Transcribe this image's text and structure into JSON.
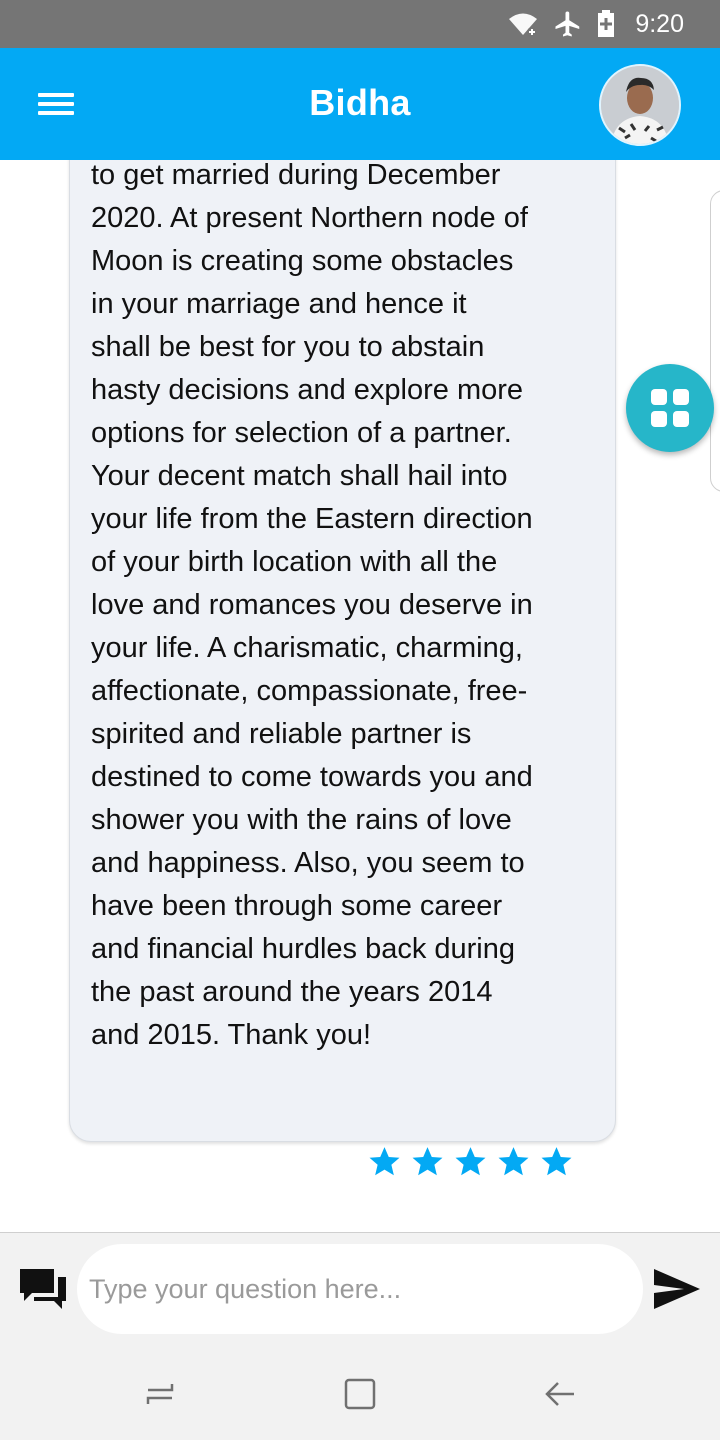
{
  "status_bar": {
    "time": "9:20",
    "icons": [
      "wifi-icon",
      "airplane-mode-icon",
      "battery-icon"
    ]
  },
  "header": {
    "title": "Bidha",
    "menu_icon": "hamburger-menu-icon",
    "avatar": "user-avatar"
  },
  "message": {
    "text": "foreseen circumstances, you have\nanother equally favorable time\nto get married during December\n2020. At present Northern node of\nMoon is creating some obstacles\nin your marriage and hence it\nshall be best for you to abstain\nhasty decisions and explore more\noptions for selection of a partner.\nYour decent match shall hail into\nyour life from the Eastern direction\nof your birth location with all the\nlove and romances you deserve in\nyour life. A charismatic, charming,\naffectionate, compassionate, free-\nspirited and reliable partner is\ndestined to come towards you and\nshower you with the rains of love\nand happiness. Also, you seem to\nhave been through some career\nand financial hurdles back during\nthe past around the years 2014\nand 2015. Thank you!",
    "rating": 5,
    "rating_max": 5,
    "rating_color": "#03a9f4"
  },
  "fab": {
    "icon": "apps-grid-icon",
    "color": "#26b6c9"
  },
  "composer": {
    "chat_icon": "chat-bubbles-icon",
    "input_value": "",
    "input_placeholder": "Type your question here...",
    "send_icon": "send-icon"
  },
  "nav_bar": {
    "icons": [
      "recent-apps-icon",
      "home-icon",
      "back-icon"
    ]
  },
  "colors": {
    "status_bar": "#757575",
    "app_bar": "#03a9f4",
    "bubble": "#eff2f7"
  }
}
